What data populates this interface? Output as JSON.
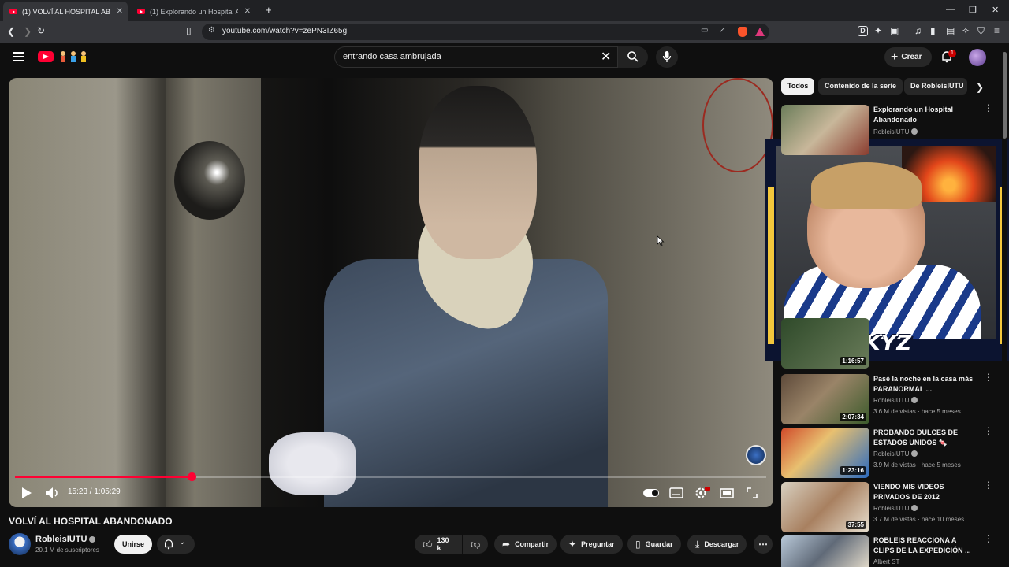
{
  "browser": {
    "tabs": [
      {
        "title": "(1) VOLVÍ AL HOSPITAL ABANDONADO",
        "active": true
      },
      {
        "title": "(1) Explorando un Hospital Abandonado",
        "active": false
      }
    ],
    "new_tab": "+",
    "url": "youtube.com/watch?v=zePN3IZ65gI"
  },
  "header": {
    "search_query": "entrando casa ambrujada",
    "create_label": "Crear",
    "notifications_count": "1"
  },
  "player": {
    "time": "15:23 / 1:05:29",
    "progress_fraction": 0.235
  },
  "overlay": {
    "brand": "LUUKYZ"
  },
  "video": {
    "title": "VOLVÍ AL HOSPITAL ABANDONADO",
    "channel": "RobleisIUTU",
    "subscribers": "20.1 M de suscriptores",
    "join_label": "Unirse",
    "likes": "130 k",
    "share_label": "Compartir",
    "ask_label": "Preguntar",
    "save_label": "Guardar",
    "download_label": "Descargar"
  },
  "sidebar": {
    "chips": [
      "Todos",
      "Contenido de la serie",
      "De RobleisIUTU"
    ],
    "items": [
      {
        "title": "Explorando un Hospital Abandonado",
        "channel": "RobleisIUTU",
        "meta": "",
        "duration": ""
      },
      {
        "title": "",
        "channel": "",
        "meta": "",
        "duration": "1:16:57"
      },
      {
        "title": "Pasé la noche en la casa más PARANORMAL ...",
        "channel": "RobleisIUTU",
        "meta": "3.6 M de vistas · hace 5 meses",
        "duration": "2:07:34"
      },
      {
        "title": "PROBANDO DULCES DE ESTADOS UNIDOS 🍬",
        "channel": "RobleisIUTU",
        "meta": "3.9 M de vistas · hace 5 meses",
        "duration": "1:23:16"
      },
      {
        "title": "VIENDO MIS VIDEOS PRIVADOS DE 2012",
        "channel": "RobleisIUTU",
        "meta": "3.7 M de vistas · hace 10 meses",
        "duration": "37:55"
      },
      {
        "title": "ROBLEIS REACCIONA A CLIPS DE LA EXPEDICIÓN ...",
        "channel": "Albert ST",
        "meta": "",
        "duration": ""
      }
    ]
  },
  "colors": {
    "accent_red": "#ff0033",
    "background": "#0f0f0f",
    "overlay_gold": "#f3c73c"
  }
}
